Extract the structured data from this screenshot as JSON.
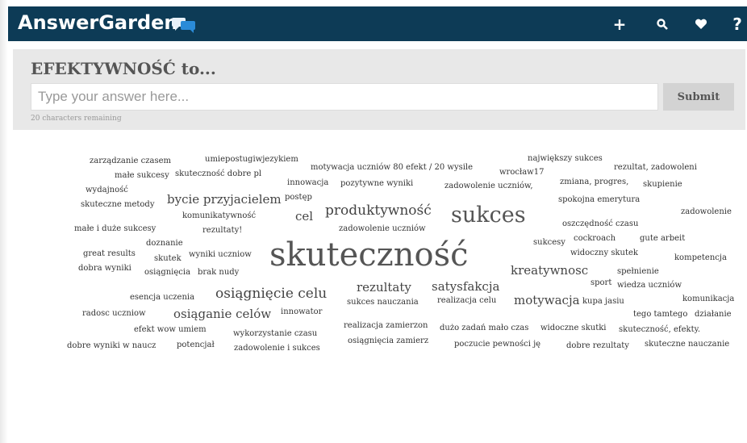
{
  "header": {
    "brand": "AnswerGarden",
    "brand_icon": "speech-bubbles-icon",
    "nav": [
      {
        "icon": "plus-icon",
        "symbol": "+"
      },
      {
        "icon": "search-icon",
        "symbol": "search"
      },
      {
        "icon": "heart-icon",
        "symbol": "heart"
      },
      {
        "icon": "help-icon",
        "symbol": "?"
      }
    ],
    "bar_color": "#0d3b56"
  },
  "question": {
    "title": "EFEKTYWNOŚĆ to...",
    "placeholder": "Type your answer here...",
    "input_value": "",
    "submit_label": "Submit",
    "remaining": "20 characters remaining"
  },
  "cloud": {
    "words": [
      {
        "text": "zarządzanie czasem",
        "size": "s1"
      },
      {
        "text": "umiepostugiwjezykiem",
        "size": "s1"
      },
      {
        "text": "motywacja uczniów 80 efekt / 20 wysile",
        "size": "s1"
      },
      {
        "text": "największy sukces",
        "size": "s1"
      },
      {
        "text": "małe sukcesy",
        "size": "s1"
      },
      {
        "text": "skuteczność dobre pl",
        "size": "s1"
      },
      {
        "text": "wrocław17",
        "size": "s1"
      },
      {
        "text": "rezultat, zadowoleni",
        "size": "s1"
      },
      {
        "text": "innowacja",
        "size": "s1"
      },
      {
        "text": "pozytywne wyniki",
        "size": "s1"
      },
      {
        "text": "zadowolenie uczniów,",
        "size": "s1"
      },
      {
        "text": "zmiana, progres,",
        "size": "s1"
      },
      {
        "text": "skupienie",
        "size": "s1"
      },
      {
        "text": "wydajność",
        "size": "s1"
      },
      {
        "text": "postęp",
        "size": "s1"
      },
      {
        "text": "bycie przyjacielem",
        "size": "s3"
      },
      {
        "text": "skuteczne metody",
        "size": "s1"
      },
      {
        "text": "spokojna emerytura",
        "size": "s1"
      },
      {
        "text": "produktywność",
        "size": "s4"
      },
      {
        "text": "sukces",
        "size": "s5"
      },
      {
        "text": "cel",
        "size": "s3"
      },
      {
        "text": "komunikatywność",
        "size": "s1"
      },
      {
        "text": "zadowolenie",
        "size": "s1"
      },
      {
        "text": "oszczędność czasu",
        "size": "s1"
      },
      {
        "text": "małe i duże sukcesy",
        "size": "s1"
      },
      {
        "text": "rezultaty!",
        "size": "s1"
      },
      {
        "text": "zadowolenie uczniów",
        "size": "s1"
      },
      {
        "text": "cockroach",
        "size": "s1"
      },
      {
        "text": "gute arbeit",
        "size": "s1"
      },
      {
        "text": "doznanie",
        "size": "s1"
      },
      {
        "text": "sukcesy",
        "size": "s1"
      },
      {
        "text": "great results",
        "size": "s1"
      },
      {
        "text": "wyniki uczniow",
        "size": "s1"
      },
      {
        "text": "skuteczność",
        "size": "s6"
      },
      {
        "text": "widoczny skutek",
        "size": "s1"
      },
      {
        "text": "skutek",
        "size": "s1"
      },
      {
        "text": "kompetencja",
        "size": "s1"
      },
      {
        "text": "dobra wyniki",
        "size": "s1"
      },
      {
        "text": "osiągnięcia",
        "size": "s1"
      },
      {
        "text": "brak nudy",
        "size": "s1"
      },
      {
        "text": "kreatywnosc",
        "size": "s3"
      },
      {
        "text": "spełnienie",
        "size": "s1"
      },
      {
        "text": "sport",
        "size": "s1"
      },
      {
        "text": "wiedza uczniów",
        "size": "s1"
      },
      {
        "text": "rezultaty",
        "size": "s3"
      },
      {
        "text": "satysfakcja",
        "size": "s3"
      },
      {
        "text": "osiągnięcie celu",
        "size": "s4"
      },
      {
        "text": "esencja uczenia",
        "size": "s1"
      },
      {
        "text": "motywacja",
        "size": "s3"
      },
      {
        "text": "komunikacja",
        "size": "s1"
      },
      {
        "text": "sukces nauczania",
        "size": "s1"
      },
      {
        "text": "realizacja celu",
        "size": "s1"
      },
      {
        "text": "kupa jasiu",
        "size": "s1"
      },
      {
        "text": "radosc uczniow",
        "size": "s1"
      },
      {
        "text": "osiąganie celów",
        "size": "s3"
      },
      {
        "text": "innowator",
        "size": "s1"
      },
      {
        "text": "tego tamtego",
        "size": "s1"
      },
      {
        "text": "działanie",
        "size": "s1"
      },
      {
        "text": "efekt wow umiem",
        "size": "s1"
      },
      {
        "text": "realizacja zamierzon",
        "size": "s1"
      },
      {
        "text": "dużo zadań mało czas",
        "size": "s1"
      },
      {
        "text": "widoczne skutki",
        "size": "s1"
      },
      {
        "text": "skuteczność, efekty.",
        "size": "s1"
      },
      {
        "text": "wykorzystanie czasu",
        "size": "s1"
      },
      {
        "text": "osiągnięcia zamierz",
        "size": "s1"
      },
      {
        "text": "dobre wyniki w naucz",
        "size": "s1"
      },
      {
        "text": "potencjał",
        "size": "s1"
      },
      {
        "text": "zadowolenie i sukces",
        "size": "s1"
      },
      {
        "text": "poczucie pewności ję",
        "size": "s1"
      },
      {
        "text": "dobre rezultaty",
        "size": "s1"
      },
      {
        "text": "skuteczne nauczanie",
        "size": "s1"
      }
    ]
  }
}
